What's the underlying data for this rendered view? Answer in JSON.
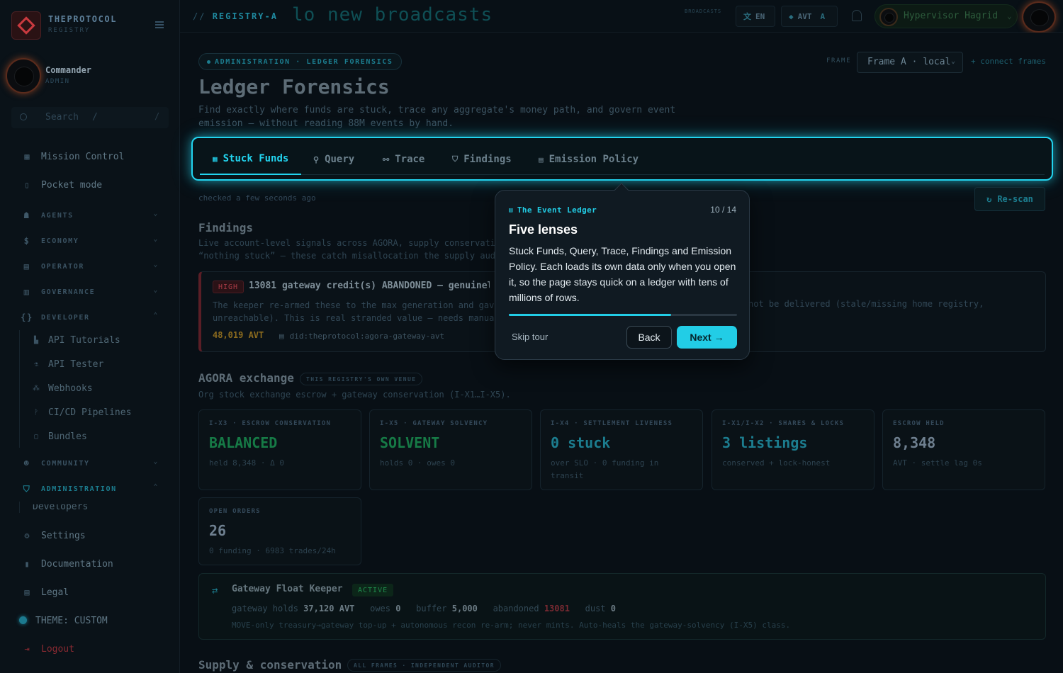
{
  "brand": {
    "title": "THEPROTOCOL",
    "subtitle": "REGISTRY"
  },
  "user_card": {
    "name": "Commander",
    "role": "ADMIN"
  },
  "search": {
    "placeholder": "Search",
    "shortcut": "/"
  },
  "sidebar": {
    "top": [
      "Mission Control",
      "Pocket mode"
    ],
    "sections": [
      "AGENTS",
      "ECONOMY",
      "OPERATOR",
      "GOVERNANCE",
      "DEVELOPER",
      "COMMUNITY",
      "ADMINISTRATION"
    ],
    "developer_items": [
      "API Tutorials",
      "API Tester",
      "Webhooks",
      "CI/CD Pipelines",
      "Bundles"
    ],
    "admin_partial": "Developers",
    "bottom": [
      "Settings",
      "Documentation",
      "Legal"
    ],
    "theme": "THEME: CUSTOM",
    "logout": "Logout"
  },
  "topbar": {
    "crumb_prefix": "//",
    "crumb": "REGISTRY-A",
    "broadcast": "lo new broadcasts",
    "broadcast_tag": "BROADCASTS",
    "lang": "EN",
    "currency": "AVT",
    "currency_suffix": "A",
    "user": "Hypervisor Hagrid"
  },
  "header": {
    "tag": "ADMINISTRATION · LEDGER FORENSICS",
    "frame_label": "FRAME",
    "frame_value": "Frame A · local",
    "connect": "+ connect frames",
    "title": "Ledger Forensics",
    "description": "Find exactly where funds are stuck, trace any aggregate's money path, and govern event emission — without reading 88M events by hand."
  },
  "tabs": [
    "Stuck Funds",
    "Query",
    "Trace",
    "Findings",
    "Emission Policy"
  ],
  "status": {
    "checked": "checked a few seconds ago",
    "rescan": "Re-scan"
  },
  "findings": {
    "title": "Findings",
    "desc1": "Live account-level signals across AGORA, supply conservati",
    "desc2": "“nothing stuck” — these catch misallocation the supply aud",
    "severity": "HIGH",
    "item_title": "13081 gateway credit(s) ABANDONED — genuinely",
    "item_desc": "The keeper re-armed these to the max generation and gav unreachable). This is real stranded value — needs manua",
    "item_desc_right": "not be delivered (stale/missing home registry,",
    "amount": "48,019 AVT",
    "did": "did:theprotocol:agora-gateway-avt"
  },
  "agora": {
    "title": "AGORA exchange",
    "venue": "THIS REGISTRY'S OWN VENUE",
    "desc": "Org stock exchange escrow + gateway conservation (I-X1…I-X5).",
    "cards": [
      {
        "k": "I-X3 · ESCROW CONSERVATION",
        "v": "BALANCED",
        "s": "held 8,348 · Δ 0"
      },
      {
        "k": "I-X5 · GATEWAY SOLVENCY",
        "v": "SOLVENT",
        "s": "holds 0 · owes 0"
      },
      {
        "k": "I-X4 · SETTLEMENT LIVENESS",
        "v": "0 stuck",
        "s": "over SLO · 0 funding in transit"
      },
      {
        "k": "I-X1/I-X2 · SHARES & LOCKS",
        "v": "3 listings",
        "s": "conserved + lock-honest"
      },
      {
        "k": "ESCROW HELD",
        "v": "8,348",
        "s": "AVT · settle lag 0s"
      },
      {
        "k": "OPEN ORDERS",
        "v": "26",
        "s": "0 funding · 6983 trades/24h"
      }
    ]
  },
  "keeper": {
    "title": "Gateway Float Keeper",
    "status": "ACTIVE",
    "l_holds": "gateway holds",
    "v_holds": "37,120 AVT",
    "l_owes": "owes",
    "v_owes": "0",
    "l_buffer": "buffer",
    "v_buffer": "5,000",
    "l_abandoned": "abandoned",
    "v_abandoned": "13081",
    "l_dust": "dust",
    "v_dust": "0",
    "note": "MOVE-only treasury→gateway top-up + autonomous recon re-arm; never mints. Auto-heals the gateway-solvency (I-X5) class."
  },
  "supply": {
    "title": "Supply & conservation",
    "tag": "ALL FRAMES · INDEPENDENT AUDITOR"
  },
  "tour": {
    "chip": "The Event Ledger",
    "step": "10 / 14",
    "progress": 0.71,
    "title": "Five lenses",
    "body": "Stuck Funds, Query, Trace, Findings and Emission Policy. Each loads its own data only when you open it, so the page stays quick on a ledger with tens of millions of rows.",
    "skip": "Skip tour",
    "back": "Back",
    "next": "Next →"
  },
  "colors": {
    "accent": "#22d4ef",
    "success": "#167a46",
    "danger": "#a63a45",
    "warning": "#8a6a1e"
  }
}
